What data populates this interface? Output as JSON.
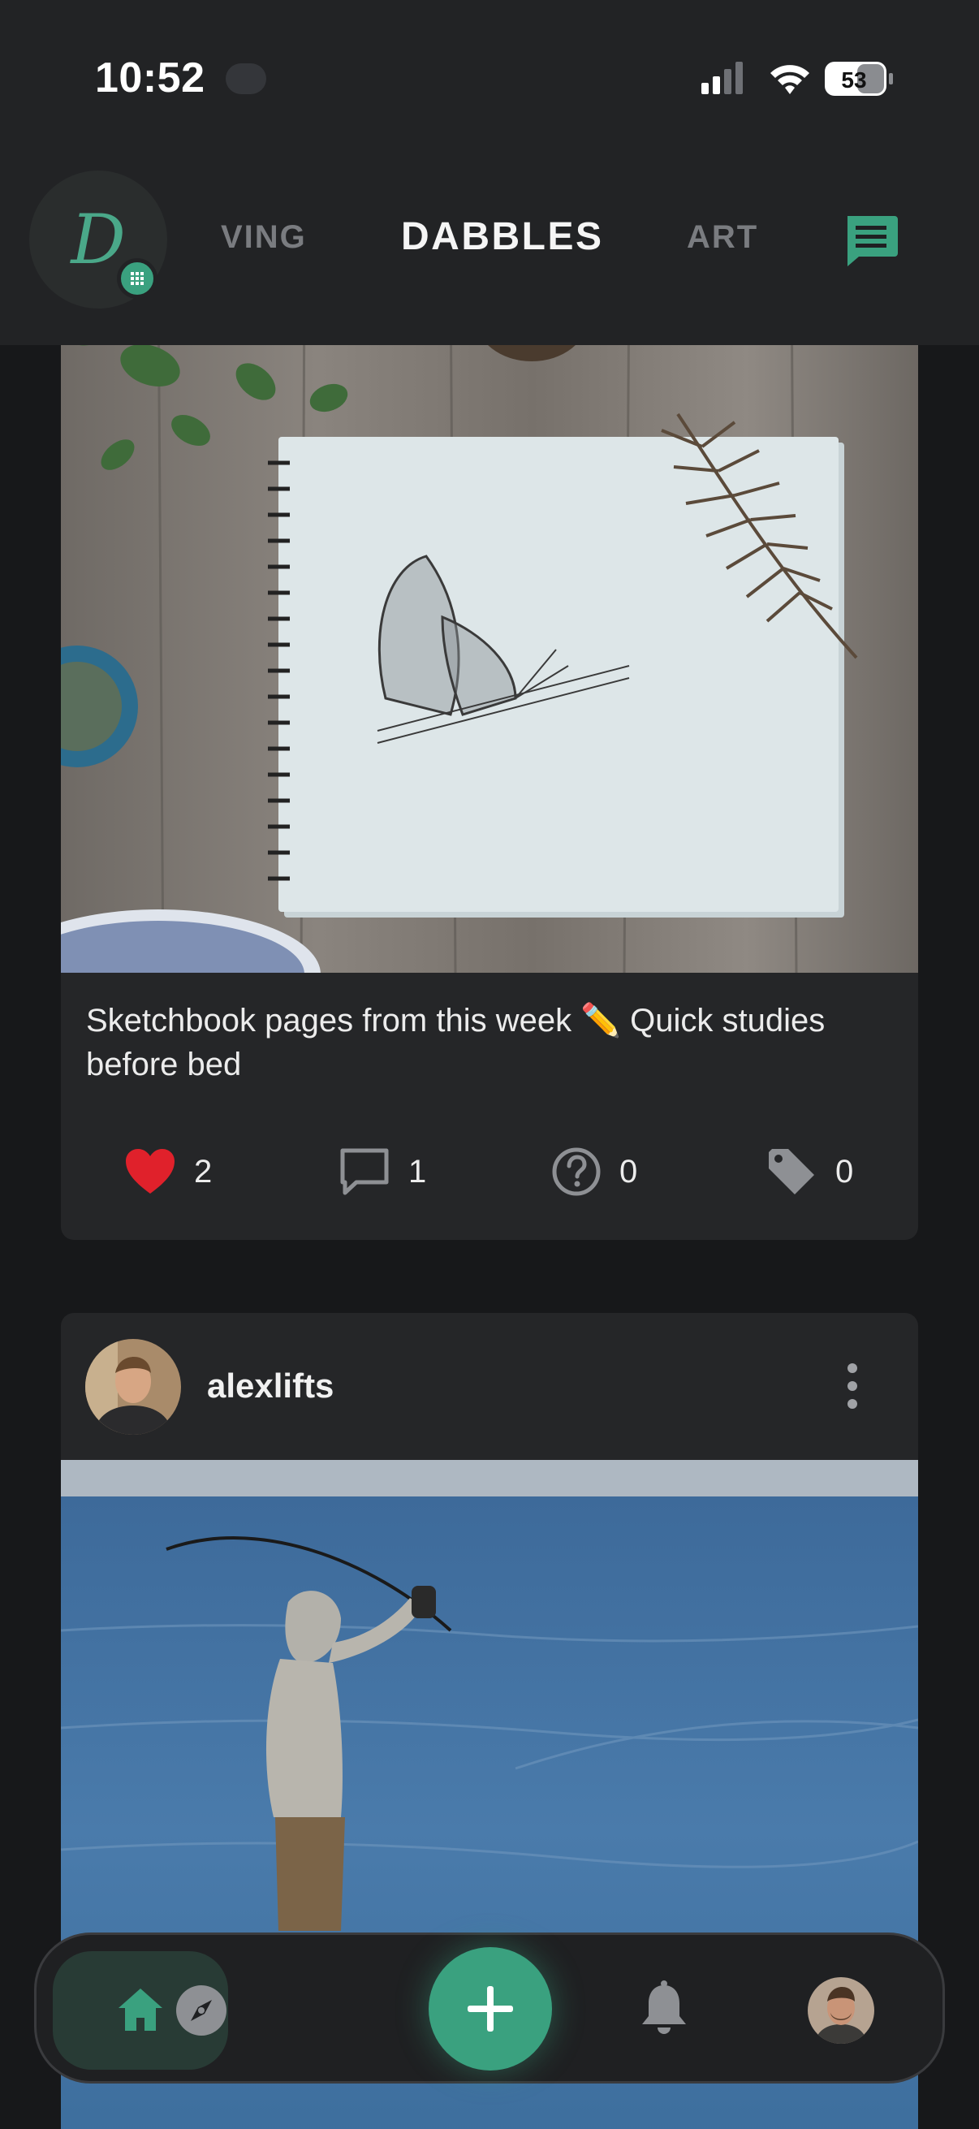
{
  "status_bar": {
    "time": "10:52",
    "battery": "53"
  },
  "header": {
    "logo_letter": "D",
    "tabs": [
      "VING",
      "DABBLES",
      "ART"
    ]
  },
  "feed": {
    "post1": {
      "caption": "Sketchbook pages from this week ✏️ Quick studies before bed",
      "likes": "2",
      "comments": "1",
      "questions": "0",
      "tags": "0"
    },
    "post2": {
      "username": "alexlifts"
    }
  },
  "colors": {
    "accent": "#3aa17f",
    "like": "#e0212b",
    "background": "#17181a",
    "card": "#252628"
  },
  "icons": {
    "home": "home-icon",
    "explore": "compass-icon",
    "add": "plus-icon",
    "notifications": "bell-icon",
    "chat": "chat-icon"
  }
}
